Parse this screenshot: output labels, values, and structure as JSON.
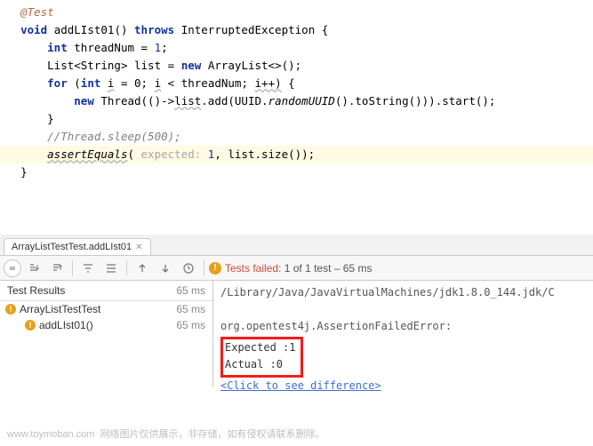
{
  "editor": {
    "annotation": "@Test",
    "signature_kw_void": "void",
    "signature_name": "addLIst01",
    "signature_throws_kw": "throws",
    "signature_exc": "InterruptedException",
    "brace_open": "{",
    "line_int_kw": "int",
    "line_int_var": "threadNum",
    "line_int_eq": "=",
    "line_int_val": "1",
    "line_list_decl_a": "List<String>",
    "line_list_var": "list",
    "line_list_eq": "=",
    "line_list_new": "new",
    "line_list_ctor": "ArrayList<>();",
    "for_kw": "for",
    "for_open": "(",
    "for_int": "int",
    "for_i": "i",
    "for_eq": "= 0;",
    "for_cond_i": "i",
    "for_cond_rest": "< threadNum;",
    "for_inc": "i++)",
    "for_brace": "{",
    "thread_new": "new",
    "thread_class": "Thread",
    "thread_lambda_a": "(()->",
    "thread_list": "list",
    "thread_add": ".add(UUID.",
    "thread_random": "randomUUID",
    "thread_rest": "().toString())).start();",
    "brace_close_inner": "}",
    "comment": "//Thread.sleep(500);",
    "assert_call": "assertEquals",
    "assert_hint": "expected:",
    "assert_val": "1",
    "assert_rest": ", list.size());",
    "brace_close_outer": "}"
  },
  "tab": {
    "label": "ArrayListTestTest.addLIst01"
  },
  "toolbar": {
    "status_prefix": "Tests failed:",
    "status_rest": "1 of 1 test – 65 ms"
  },
  "tree": {
    "header": "Test Results",
    "header_time": "65 ms",
    "row1": "ArrayListTestTest",
    "row1_time": "65 ms",
    "row2": "addLIst01()",
    "row2_time": "65 ms"
  },
  "console": {
    "path": "/Library/Java/JavaVirtualMachines/jdk1.8.0_144.jdk/C",
    "error": "org.opentest4j.AssertionFailedError:",
    "expected": "Expected :1",
    "actual": "Actual   :0",
    "diff": "<Click to see difference>"
  },
  "watermark": {
    "site": "www.toymoban.com",
    "text": "网络图片仅供展示，非存储，如有侵权请联系删除。"
  }
}
